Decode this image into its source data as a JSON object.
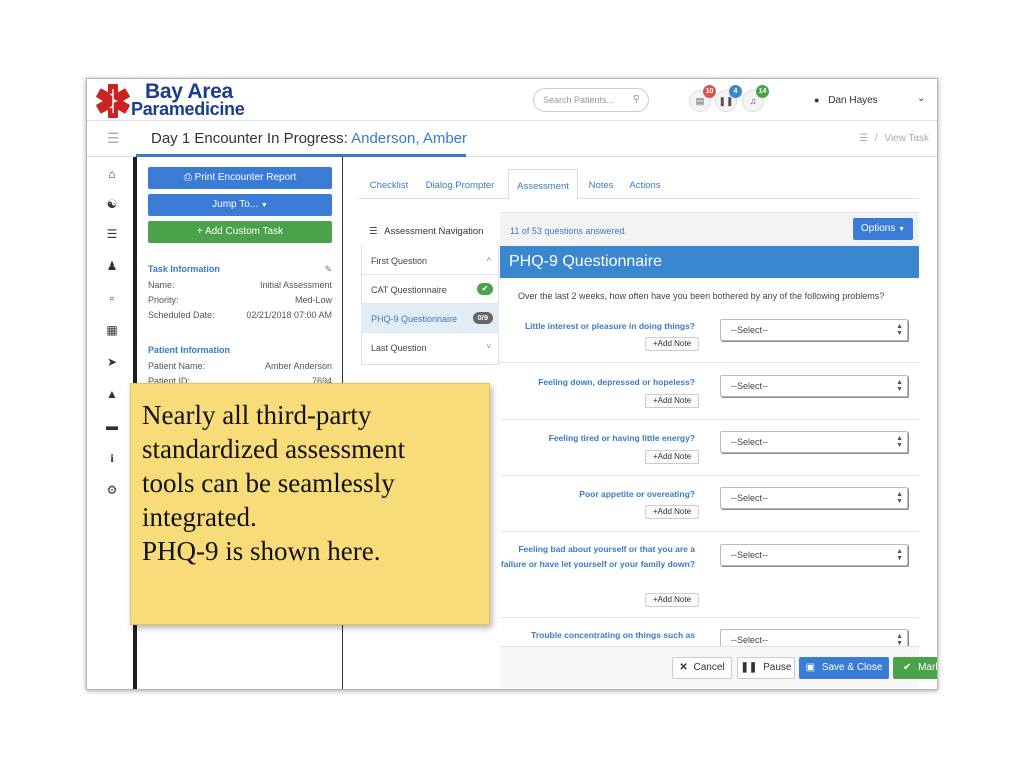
{
  "app": {
    "logo_line1": "Bay Area",
    "logo_line2": "Paramedicine",
    "brand_color": "#cc2222",
    "search_placeholder": "Search Patients...",
    "badges": [
      {
        "icon": "inbox-icon",
        "count": "10",
        "color": "#d9534f"
      },
      {
        "icon": "pause-icon",
        "count": "4",
        "color": "#3a86cf"
      },
      {
        "icon": "bell-icon",
        "count": "14",
        "color": "#4aa34a"
      }
    ],
    "user_name": "Dan Hayes"
  },
  "header": {
    "title_prefix": "Day 1 Encounter In Progress:",
    "patient": "Anderson, Amber",
    "breadcrumb_sep": "/",
    "view_task": "View Task"
  },
  "rail_icons": [
    "home-icon",
    "users-icon",
    "list-icon",
    "user-icon",
    "pdf-icon",
    "calendar-icon",
    "share-icon",
    "graduation-icon",
    "folder-icon",
    "info-icon",
    "gear-icon"
  ],
  "left_panel": {
    "print_btn": "Print Encounter Report",
    "jump_btn": "Jump To...",
    "add_btn": "Add Custom Task",
    "task_info": {
      "heading": "Task Information",
      "rows": [
        {
          "label": "Name:",
          "value": "Initial Assessment"
        },
        {
          "label": "Priority:",
          "value": "Med-Low"
        },
        {
          "label": "Scheduled Date:",
          "value": "02/21/2018 07:00 AM"
        }
      ]
    },
    "patient_info": {
      "heading": "Patient Information",
      "rows": [
        {
          "label": "Patient Name:",
          "value": "Amber Anderson"
        },
        {
          "label": "Patient ID:",
          "value": "7694"
        }
      ]
    }
  },
  "tabs": [
    "Checklist",
    "Dialog Prompter",
    "Assessment",
    "Notes",
    "Actions"
  ],
  "active_tab": "Assessment",
  "assessment_nav": {
    "heading": "Assessment Navigation",
    "items": [
      {
        "label": "First Question",
        "badge": ""
      },
      {
        "label": "CAT Questionnaire",
        "badge": "✔"
      },
      {
        "label": "PHQ-9 Questionnaire",
        "badge": "0/9"
      },
      {
        "label": "Last Question",
        "badge": ""
      }
    ]
  },
  "main": {
    "answered": "11 of 53 questions answered.",
    "options_btn": "Options",
    "section_title": "PHQ-9 Questionnaire",
    "intro": "Over the last 2 weeks, how often have you been bothered by any of the following problems?",
    "add_note": "Add Note",
    "select_placeholder": "--Select--",
    "questions": [
      "Little interest or pleasure in doing things?",
      "Feeling down, depressed or hopeless?",
      "Feeling tired or having little energy?",
      "Poor appetite or overeating?",
      "Feeling bad about yourself or that you are a failure or have let yourself or your family down?",
      "Trouble concentrating on things such as"
    ]
  },
  "footer": {
    "cancel": "Cancel",
    "pause": "Pause",
    "save": "Save & Close",
    "complete": "Mark Complete"
  },
  "callout": {
    "lines": [
      "Nearly all third-party",
      "standardized assessment",
      "tools can be seamlessly",
      "integrated.",
      "PHQ-9 is shown here."
    ]
  }
}
